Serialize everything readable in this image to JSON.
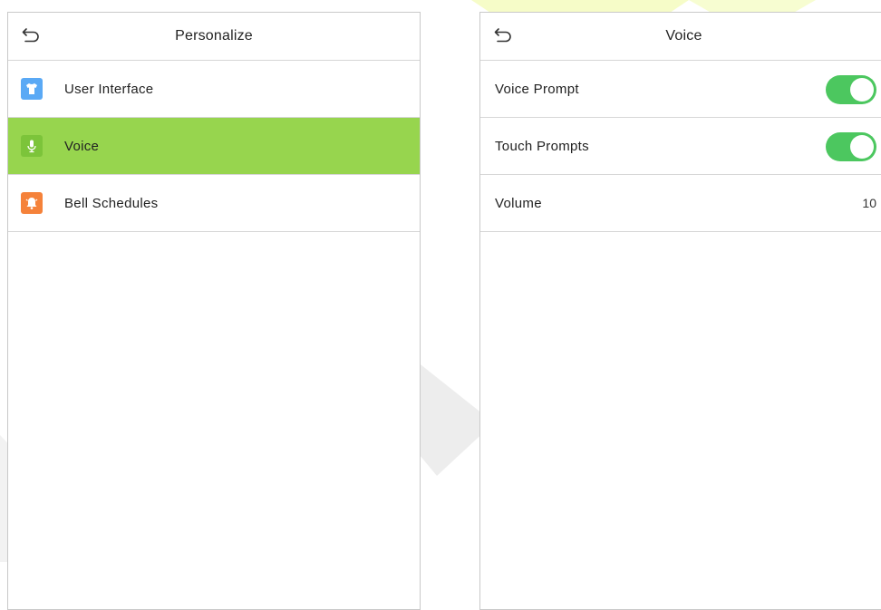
{
  "left_panel": {
    "title": "Personalize",
    "back_icon": "back-arrow-icon",
    "items": [
      {
        "label": "User Interface",
        "icon": "shirt-icon",
        "icon_color": "#5aa9f5",
        "selected": false
      },
      {
        "label": "Voice",
        "icon": "microphone-icon",
        "icon_color": "#7cc43a",
        "selected": true
      },
      {
        "label": "Bell Schedules",
        "icon": "bell-icon",
        "icon_color": "#f5823a",
        "selected": false
      }
    ]
  },
  "right_panel": {
    "title": "Voice",
    "back_icon": "back-arrow-icon",
    "items": [
      {
        "label": "Voice Prompt",
        "type": "toggle",
        "on": true
      },
      {
        "label": "Touch Prompts",
        "type": "toggle",
        "on": true
      },
      {
        "label": "Volume",
        "type": "value",
        "value": "10"
      }
    ]
  },
  "colors": {
    "selected_row": "#97d54e",
    "toggle_on": "#4cc75f",
    "border": "#d6d6d6"
  }
}
